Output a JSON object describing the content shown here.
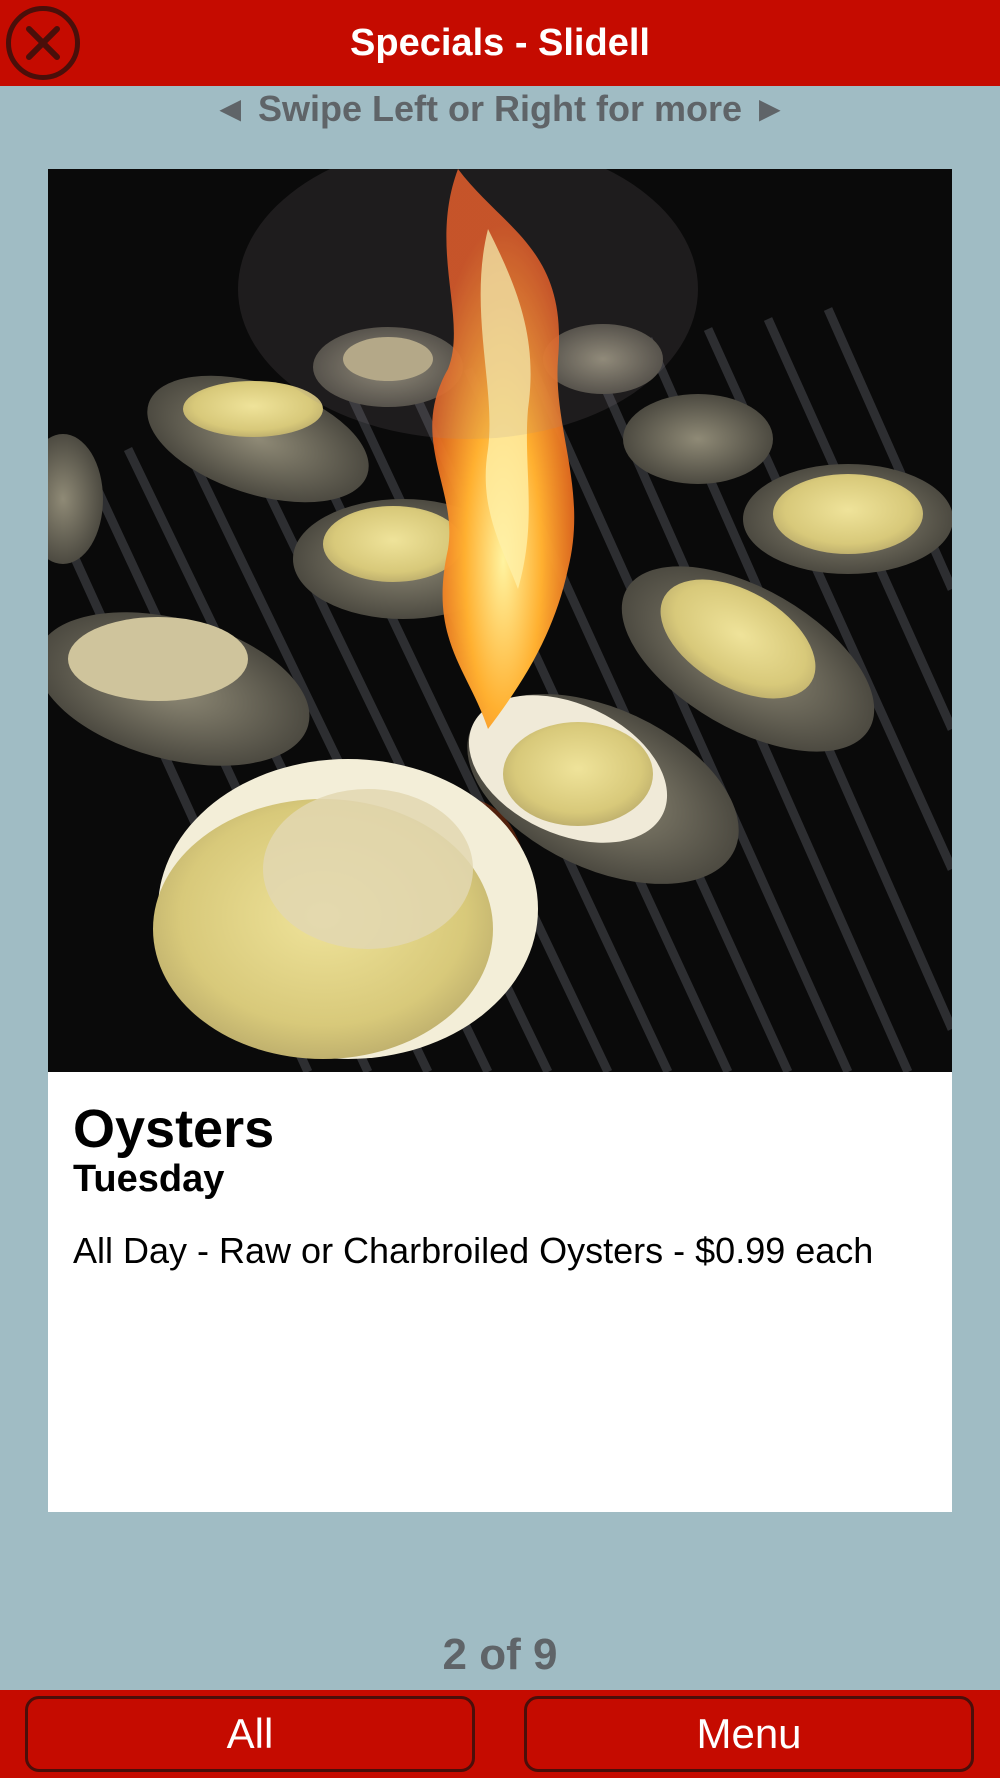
{
  "header": {
    "title": "Specials - Slidell",
    "close_icon": "close-icon"
  },
  "swipe_hint": "◄ Swipe Left or Right for more ►",
  "special": {
    "name": "Oysters",
    "day": "Tuesday",
    "description": "All Day - Raw or Charbroiled Oysters - $0.99 each",
    "image": "charbroiled-oysters-on-grill-photo"
  },
  "pager": {
    "text": "2 of 9",
    "current": 2,
    "total": 9
  },
  "footer": {
    "all_label": "All",
    "menu_label": "Menu"
  },
  "colors": {
    "header_red": "#c50b00",
    "background": "#a0bcc4",
    "muted_text": "#5f6468"
  }
}
